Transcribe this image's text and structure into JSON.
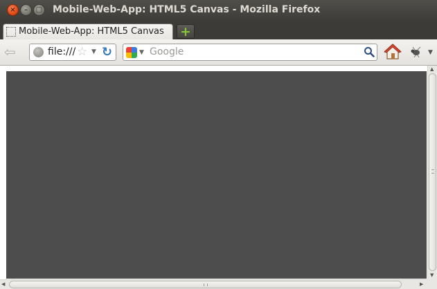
{
  "window": {
    "title": "Mobile-Web-App: HTML5 Canvas - Mozilla Firefox",
    "close_glyph": "×",
    "minimize_glyph": "–",
    "maximize_glyph": "□"
  },
  "tabs": [
    {
      "label": "Mobile-Web-App: HTML5 Canvas",
      "icon": "blank-page-icon",
      "active": true
    }
  ],
  "new_tab": {
    "glyph": "+",
    "icon": "plus-icon",
    "color": "#84c53c"
  },
  "navbar": {
    "back_glyph": "⇦",
    "url": "file:///",
    "bookmark_star_glyph": "☆",
    "dropdown_glyph": "▼",
    "reload_glyph": "↻",
    "search_placeholder": "Google",
    "search_engine_icon": "google-icon",
    "search_button_icon": "magnifier-icon",
    "home_icon": "home-icon",
    "addon_icon": "bug-addon-icon"
  },
  "content": {
    "canvas_color": "#4d4d4d"
  },
  "colors": {
    "titlebar": "#3c3b37",
    "close_button": "#df4b16",
    "toolbar": "#ecebe8",
    "reload": "#3478b8"
  }
}
